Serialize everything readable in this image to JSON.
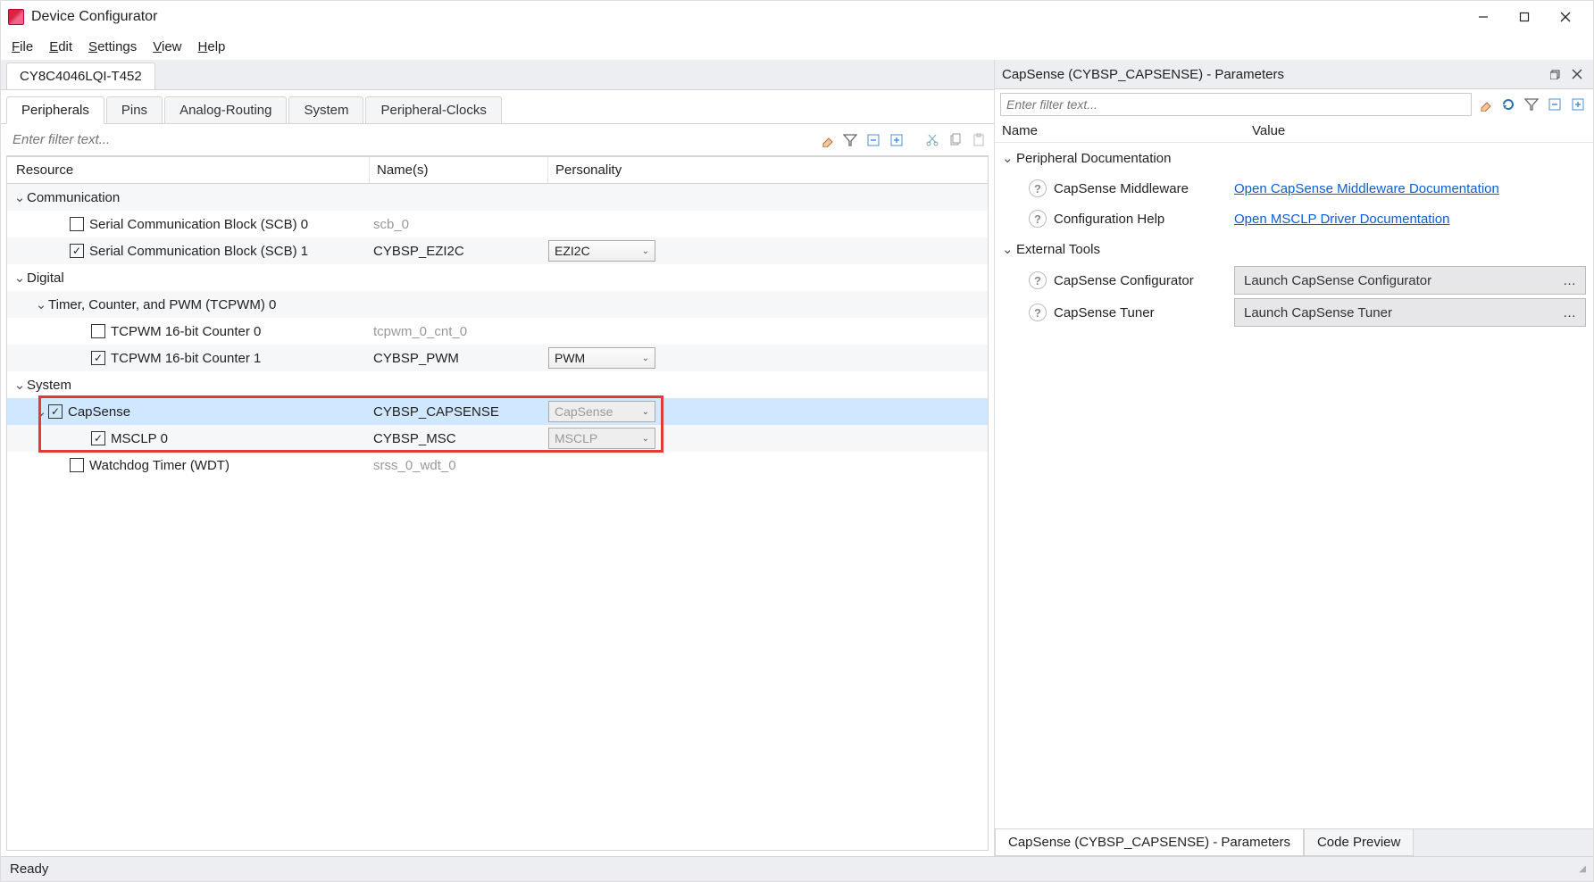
{
  "app": {
    "title": "Device Configurator",
    "status": "Ready",
    "device": "CY8C4046LQI-T452"
  },
  "menu": {
    "file": "File",
    "edit": "Edit",
    "settings": "Settings",
    "view": "View",
    "help": "Help"
  },
  "tabs": {
    "peripherals": "Peripherals",
    "pins": "Pins",
    "analog": "Analog-Routing",
    "system": "System",
    "clocks": "Peripheral-Clocks"
  },
  "filter": {
    "placeholder": "Enter filter text..."
  },
  "columns": {
    "resource": "Resource",
    "names": "Name(s)",
    "personality": "Personality"
  },
  "tree": {
    "comm": {
      "label": "Communication",
      "scb0": {
        "label": "Serial Communication Block (SCB) 0",
        "name": "scb_0"
      },
      "scb1": {
        "label": "Serial Communication Block (SCB) 1",
        "name": "CYBSP_EZI2C",
        "personality": "EZI2C"
      }
    },
    "digital": {
      "label": "Digital",
      "tcpwm": {
        "label": "Timer, Counter, and PWM (TCPWM) 0",
        "cnt0": {
          "label": "TCPWM 16-bit Counter 0",
          "name": "tcpwm_0_cnt_0"
        },
        "cnt1": {
          "label": "TCPWM 16-bit Counter 1",
          "name": "CYBSP_PWM",
          "personality": "PWM"
        }
      }
    },
    "system": {
      "label": "System",
      "capsense": {
        "label": "CapSense",
        "name": "CYBSP_CAPSENSE",
        "personality": "CapSense"
      },
      "msclp": {
        "label": "MSCLP 0",
        "name": "CYBSP_MSC",
        "personality": "MSCLP"
      },
      "wdt": {
        "label": "Watchdog Timer (WDT)",
        "name": "srss_0_wdt_0"
      }
    }
  },
  "right": {
    "title": "CapSense (CYBSP_CAPSENSE) - Parameters",
    "filter_placeholder": "Enter filter text...",
    "header_name": "Name",
    "header_value": "Value",
    "group_doc": "Peripheral Documentation",
    "doc_mw": "CapSense Middleware",
    "doc_mw_link": "Open CapSense Middleware Documentation",
    "doc_cfg": "Configuration Help",
    "doc_cfg_link": "Open MSCLP Driver Documentation",
    "group_tools": "External Tools",
    "tool_cfg": "CapSense Configurator",
    "tool_cfg_btn": "Launch CapSense Configurator",
    "tool_tuner": "CapSense Tuner",
    "tool_tuner_btn": "Launch CapSense Tuner",
    "bottom_tab1": "CapSense (CYBSP_CAPSENSE) - Parameters",
    "bottom_tab2": "Code Preview"
  }
}
